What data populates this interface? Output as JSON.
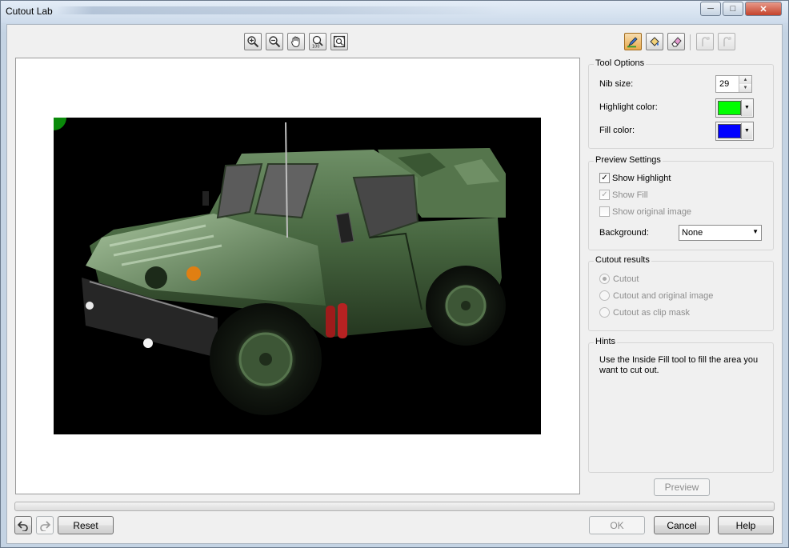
{
  "window": {
    "title": "Cutout Lab"
  },
  "view_tools": [
    {
      "name": "zoom-in-icon",
      "label": "Zoom in"
    },
    {
      "name": "zoom-out-icon",
      "label": "Zoom out"
    },
    {
      "name": "hand-pan-icon",
      "label": "Pan"
    },
    {
      "name": "zoom-100-icon",
      "label": "100"
    },
    {
      "name": "zoom-fit-icon",
      "label": "Fit"
    }
  ],
  "edit_tools": [
    {
      "name": "highlighter-icon",
      "active": true
    },
    {
      "name": "inside-fill-icon",
      "active": false
    },
    {
      "name": "eraser-icon",
      "active": false
    },
    {
      "name": "add-detail-icon",
      "disabled": true
    },
    {
      "name": "remove-detail-icon",
      "disabled": true
    }
  ],
  "tool_options": {
    "heading": "Tool Options",
    "nib_label": "Nib size:",
    "nib_value": "29",
    "highlight_label": "Highlight color:",
    "highlight_color": "#00ff00",
    "fill_label": "Fill color:",
    "fill_color": "#0000ff"
  },
  "preview_settings": {
    "heading": "Preview Settings",
    "show_highlight": "Show Highlight",
    "show_highlight_checked": true,
    "show_fill": "Show Fill",
    "show_fill_checked": true,
    "show_original": "Show original image",
    "show_original_checked": false,
    "background_label": "Background:",
    "background_value": "None"
  },
  "cutout_results": {
    "heading": "Cutout results",
    "options": [
      "Cutout",
      "Cutout and original image",
      "Cutout as clip mask"
    ],
    "selected_index": 0
  },
  "hints": {
    "heading": "Hints",
    "text": "Use the Inside Fill tool to fill the area you want to cut out."
  },
  "buttons": {
    "preview": "Preview",
    "reset": "Reset",
    "ok": "OK",
    "cancel": "Cancel",
    "help": "Help"
  },
  "colors": {
    "active_tool": "#e9a94b",
    "photo_background": "#000000",
    "vehicle_body": "#3f5f3a",
    "highlight_marker": "#0a8a0a"
  }
}
